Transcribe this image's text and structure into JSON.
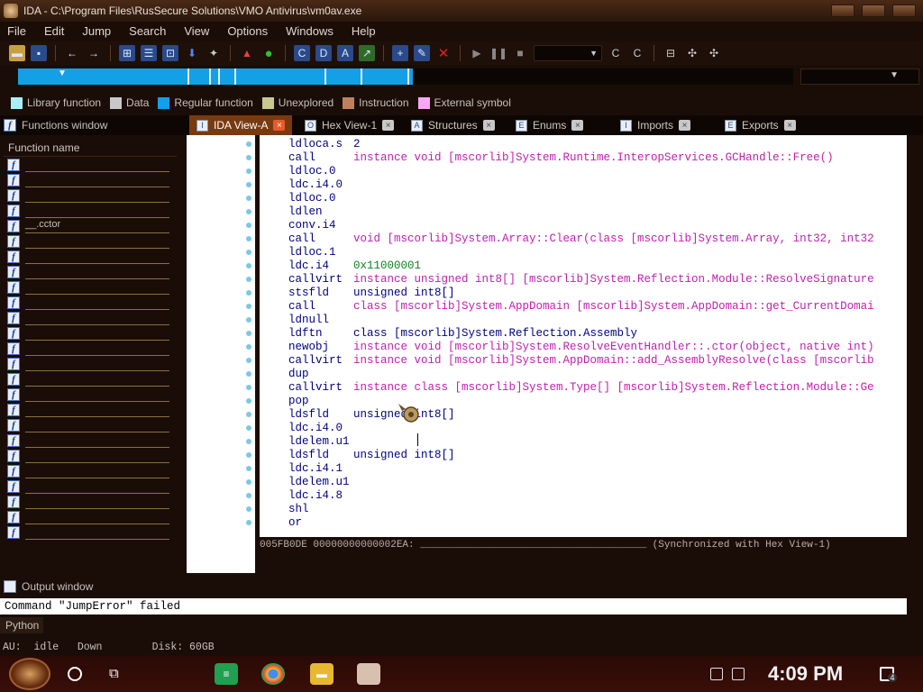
{
  "window": {
    "title": "IDA - C:\\Program Files\\RusSecure Solutions\\VMO Antivirus\\vm0av.exe"
  },
  "menu": [
    "File",
    "Edit",
    "Jump",
    "Search",
    "View",
    "Options",
    "Windows",
    "Help"
  ],
  "legend": [
    {
      "label": "Library function",
      "color": "#a8f0f8"
    },
    {
      "label": "Data",
      "color": "#c8c8c8"
    },
    {
      "label": "Regular function",
      "color": "#13a0e6"
    },
    {
      "label": "Unexplored",
      "color": "#c8c890"
    },
    {
      "label": "Instruction",
      "color": "#c08060"
    },
    {
      "label": "External symbol",
      "color": "#f8a8f0"
    }
  ],
  "functions_window": {
    "title": "Functions window",
    "header": "Function name",
    "icon_label": "f",
    "items": [
      "",
      "",
      "",
      "",
      "__.cctor",
      "",
      "",
      "",
      "",
      "",
      "",
      "",
      "",
      "",
      "",
      "",
      "",
      "",
      "",
      "",
      "",
      "",
      "",
      "",
      ""
    ]
  },
  "tabs": [
    {
      "label": "IDA View-A",
      "icon": "I"
    },
    {
      "label": "Hex View-1",
      "icon": "O"
    },
    {
      "label": "Structures",
      "icon": "A"
    },
    {
      "label": "Enums",
      "icon": "E"
    },
    {
      "label": "Imports",
      "icon": "I"
    },
    {
      "label": "Exports",
      "icon": "E"
    }
  ],
  "disassembly": [
    {
      "op": "ldloca.s",
      "arg": "2",
      "style": "blue"
    },
    {
      "op": "call",
      "arg": "instance void [mscorlib]System.Runtime.InteropServices.GCHandle::Free()",
      "style": "pink"
    },
    {
      "op": "ldloc.0",
      "arg": "",
      "style": "pink"
    },
    {
      "op": "ldc.i4.0",
      "arg": "",
      "style": "pink"
    },
    {
      "op": "ldloc.0",
      "arg": "",
      "style": "pink"
    },
    {
      "op": "ldlen",
      "arg": "",
      "style": "pink"
    },
    {
      "op": "conv.i4",
      "arg": "",
      "style": "pink"
    },
    {
      "op": "call",
      "arg": "void [mscorlib]System.Array::Clear(class [mscorlib]System.Array, int32, int32",
      "style": "pink"
    },
    {
      "op": "ldloc.1",
      "arg": "",
      "style": "pink"
    },
    {
      "op": "ldc.i4",
      "arg": "0x11000001",
      "style": "green"
    },
    {
      "op": "callvirt",
      "arg": "instance unsigned int8[] [mscorlib]System.Reflection.Module::ResolveSignature",
      "style": "pink"
    },
    {
      "op": "stsfld",
      "arg": "unsigned int8[]",
      "style": "blue"
    },
    {
      "op": "call",
      "arg": "class [mscorlib]System.AppDomain [mscorlib]System.AppDomain::get_CurrentDomai",
      "style": "pink"
    },
    {
      "op": "ldnull",
      "arg": "",
      "style": "pink"
    },
    {
      "op": "ldftn",
      "arg": "class [mscorlib]System.Reflection.Assembly",
      "style": "blue"
    },
    {
      "op": "newobj",
      "arg": "instance void [mscorlib]System.ResolveEventHandler::.ctor(object, native int)",
      "style": "pink"
    },
    {
      "op": "callvirt",
      "arg": "instance void [mscorlib]System.AppDomain::add_AssemblyResolve(class [mscorlib",
      "style": "pink"
    },
    {
      "op": "dup",
      "arg": "",
      "style": "pink"
    },
    {
      "op": "callvirt",
      "arg": "instance class [mscorlib]System.Type[] [mscorlib]System.Reflection.Module::Ge",
      "style": "pink"
    },
    {
      "op": "pop",
      "arg": "",
      "style": "pink"
    },
    {
      "op": "ldsfld",
      "arg": "unsigned int8[]",
      "style": "blue"
    },
    {
      "op": "ldc.i4.0",
      "arg": "",
      "style": "pink"
    },
    {
      "op": "ldelem.u1",
      "arg": "",
      "style": "pink"
    },
    {
      "op": "ldsfld",
      "arg": "unsigned int8[]",
      "style": "blue"
    },
    {
      "op": "ldc.i4.1",
      "arg": "",
      "style": "pink"
    },
    {
      "op": "ldelem.u1",
      "arg": "",
      "style": "pink"
    },
    {
      "op": "ldc.i4.8",
      "arg": "",
      "style": "pink"
    },
    {
      "op": "shl",
      "arg": "",
      "style": "pink"
    },
    {
      "op": "or",
      "arg": "",
      "style": "pink"
    }
  ],
  "sync_status": "005FB0DE 00000000000002EA: ______________________________________ (Synchronized with Hex View-1)",
  "output_window": {
    "title": "Output window",
    "text": "Command \"JumpError\" failed"
  },
  "python_label": "Python",
  "status": {
    "text": "AU:  idle   Down        Disk: 60GB"
  },
  "taskbar": {
    "clock": "4:09 PM",
    "notification_count": "4"
  }
}
